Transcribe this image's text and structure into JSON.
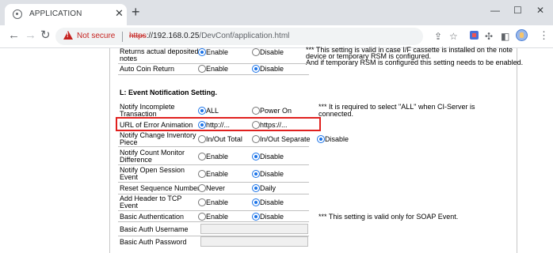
{
  "browser": {
    "tab_title": "APPLICATION",
    "tab_close": "✕",
    "new_tab": "+",
    "window_controls": {
      "minimize": "—",
      "maximize": "☐",
      "close": "✕"
    },
    "security_label": "Not secure",
    "url_scheme": "https",
    "url_host": "://192.168.0.25",
    "url_path": "/DevConf/application.html"
  },
  "page": {
    "top_note": {
      "line1": "*** This setting is valid in case I/F cassette is installed on the note",
      "line2": "device or temporary RSM is configured.",
      "line3": "And if temporary RSM is configured this setting needs to be enabled."
    },
    "rows_top": [
      {
        "label1": "Returns actual deposited",
        "label2": "notes",
        "opt1": "Enable",
        "opt2": "Disable",
        "selected": 1
      },
      {
        "label1": "Auto Coin Return",
        "opt1": "Enable",
        "opt2": "Disable",
        "selected": 2
      }
    ],
    "section_heading": "L: Event Notification Setting.",
    "notify_incomplete": {
      "label1": "Notify Incomplete",
      "label2": "Transaction",
      "opt1": "ALL",
      "opt2": "Power On",
      "selected": 1,
      "note1": "*** It is required to select \"ALL\" when CI-Server is",
      "note2": "connected."
    },
    "url_error_animation": {
      "label": "URL of Error Animation",
      "opt1": "http://...",
      "opt2": "https://...",
      "selected": 1
    },
    "notify_change_inventory": {
      "label1": "Notify Change Inventory",
      "label2": "Piece",
      "opt1": "In/Out Total",
      "opt2": "In/Out Separate",
      "opt3": "Disable",
      "selected": 3
    },
    "rows_mid": [
      {
        "label1": "Notify Count Monitor",
        "label2": "Difference",
        "opt1": "Enable",
        "opt2": "Disable",
        "selected": 2
      },
      {
        "label1": "Notify Open Session",
        "label2": "Event",
        "opt1": "Enable",
        "opt2": "Disable",
        "selected": 2
      },
      {
        "label1": "Reset Sequence Number",
        "opt1": "Never",
        "opt2": "Daily",
        "selected": 2
      },
      {
        "label1": "Add Header to TCP",
        "label2": "Event",
        "opt1": "Enable",
        "opt2": "Disable",
        "selected": 2
      },
      {
        "label1": "Basic Authentication",
        "opt1": "Enable",
        "opt2": "Disable",
        "selected": 2
      }
    ],
    "basic_auth_note": "*** This setting is valid only for SOAP Event.",
    "basic_auth_username": {
      "label": "Basic Auth Username",
      "value": ""
    },
    "basic_auth_password": {
      "label": "Basic Auth Password",
      "value": ""
    }
  }
}
